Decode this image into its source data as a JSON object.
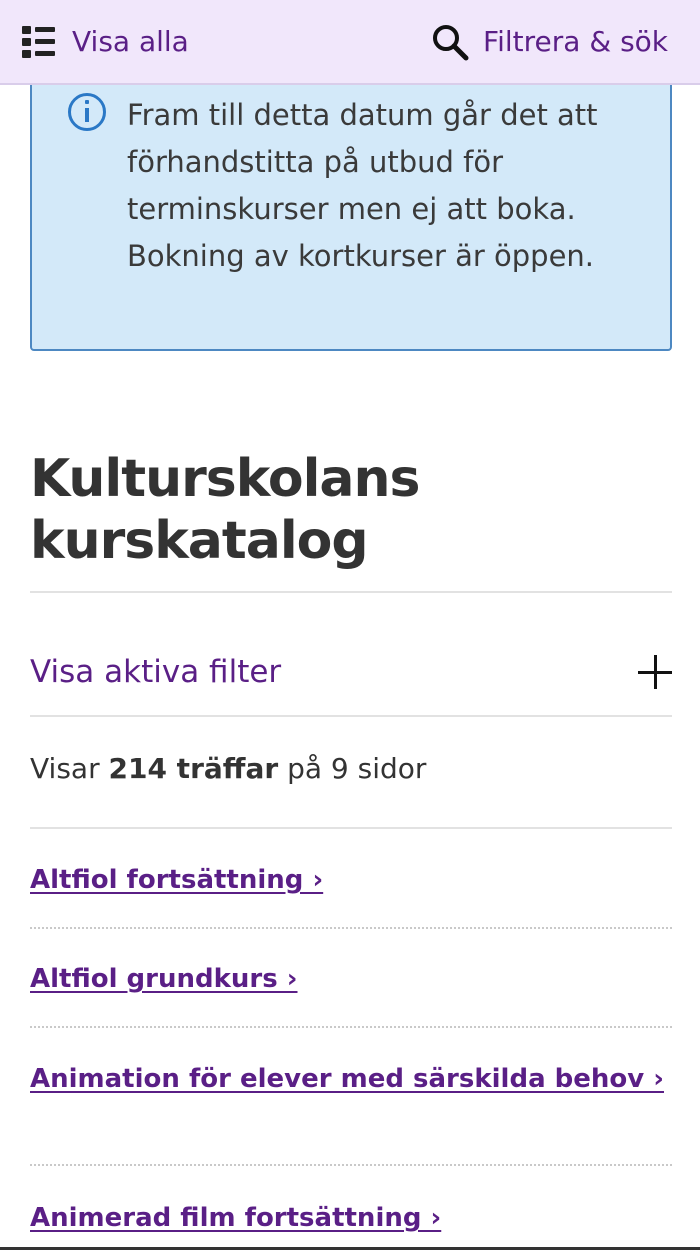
{
  "topbar": {
    "show_all_label": "Visa alla",
    "filter_search_label": "Filtrera & sök"
  },
  "info": {
    "text": "Fram till detta datum går det att förhandstitta på utbud för terminskurser men ej att boka. Bokning av kortkurser är öppen."
  },
  "page": {
    "title": "Kulturskolans kurskatalog"
  },
  "filters": {
    "toggle_label": "Visa aktiva filter"
  },
  "results": {
    "prefix": "Visar",
    "count": "214 träffar",
    "suffix": "på 9 sidor"
  },
  "courses": [
    {
      "label": "Altfiol fortsättning ›"
    },
    {
      "label": "Altfiol grundkurs ›"
    },
    {
      "label": "Animation för elever med särskilda behov ›"
    },
    {
      "label": "Animerad film fortsättning ›"
    }
  ],
  "icons": {
    "list": "list-icon",
    "search": "search-icon",
    "info": "info-icon",
    "plus": "plus-icon"
  },
  "colors": {
    "accent_purple": "#5a1f86",
    "topbar_bg": "#f1e7fb",
    "info_bg": "#d3e9f9",
    "info_border": "#4d88c2",
    "info_icon": "#2a78c6"
  }
}
